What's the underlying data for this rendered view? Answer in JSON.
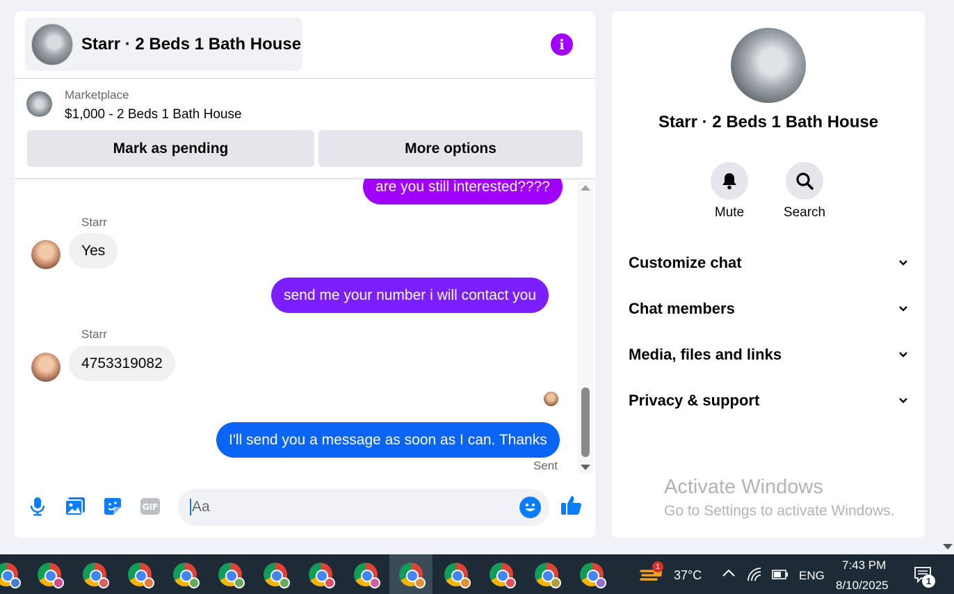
{
  "header": {
    "title": "Starr · 2 Beds 1 Bath House"
  },
  "listing": {
    "source": "Marketplace",
    "title": "$1,000 - 2 Beds 1 Bath House",
    "pending_label": "Mark as pending",
    "more_label": "More options"
  },
  "messages": [
    {
      "from": "me",
      "text": "are you still interested????"
    },
    {
      "from": "Starr",
      "sender_label": "Starr",
      "text": "Yes"
    },
    {
      "from": "me",
      "text": "send me your number i will contact you"
    },
    {
      "from": "Starr",
      "sender_label": "Starr",
      "text": "4753319082"
    },
    {
      "from": "me",
      "text": "I'll send you a message as soon as I can. Thanks"
    }
  ],
  "status": {
    "sent": "Sent"
  },
  "composer": {
    "placeholder": "Aa"
  },
  "info": {
    "title": "Starr · 2 Beds 1 Bath House",
    "mute_label": "Mute",
    "search_label": "Search",
    "sections": [
      "Customize chat",
      "Chat members",
      "Media, files and links",
      "Privacy & support"
    ]
  },
  "watermark": {
    "line1": "Activate Windows",
    "line2": "Go to Settings to activate Windows."
  },
  "taskbar": {
    "weather_badge": "1",
    "temperature": "37°C",
    "language": "ENG",
    "time": "7:43 PM",
    "date": "8/10/2025",
    "notification_count": "1"
  },
  "colors": {
    "accent_purple": "#a100ff",
    "bubble_purple": "#a100ff",
    "bubble_violet": "#7b1fff",
    "bubble_blue": "#0a64f5",
    "messenger_blue": "#0a7cff"
  }
}
